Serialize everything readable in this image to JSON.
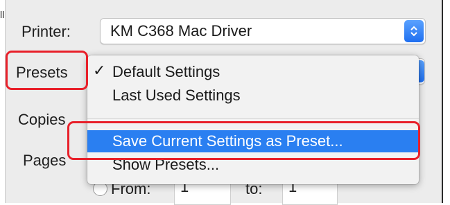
{
  "page": {
    "left_strip_text": "ll"
  },
  "printer": {
    "label": "Printer:",
    "value": "KM C368 Mac Driver"
  },
  "presets": {
    "label": "Presets",
    "menu": [
      {
        "label": "Default Settings",
        "checked": true,
        "selected": false
      },
      {
        "label": "Last Used Settings",
        "checked": false,
        "selected": false
      },
      {
        "label": "Save Current Settings as Preset...",
        "checked": false,
        "selected": true
      },
      {
        "label": "Show Presets...",
        "checked": false,
        "selected": false
      }
    ],
    "check_glyph": "✓"
  },
  "copies": {
    "label": "Copies"
  },
  "pages": {
    "label": "Pages",
    "from_label": "From:",
    "from_value": "1",
    "to_label": "to:",
    "to_value": "1"
  },
  "colors": {
    "highlight": "#2a7ff1",
    "annotation": "#e8202a",
    "stepper": "#1f6ff0"
  }
}
